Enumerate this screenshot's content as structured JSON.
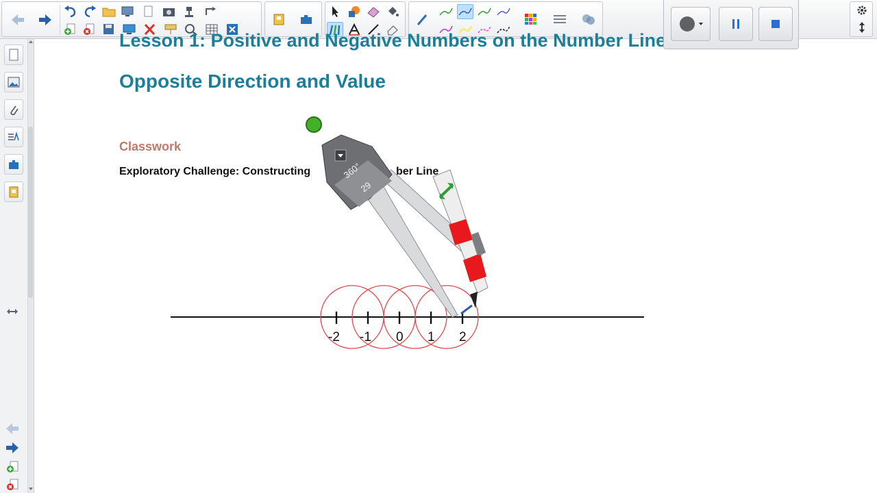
{
  "toolbar": {
    "groups": [
      "navigation",
      "edit",
      "file",
      "gallery",
      "tools",
      "pens",
      "extras"
    ]
  },
  "page": {
    "lesson_title": "Lesson 1:  Positive and Negative Numbers on the Number Line",
    "subtitle": "Opposite Direction and Value",
    "section": "Classwork",
    "challenge_pre": "Exploratory Challenge:  Constructing",
    "challenge_post": "ber Line"
  },
  "number_line": {
    "labels": [
      "-2",
      "-1",
      "0",
      "1",
      "2"
    ],
    "values": [
      -2,
      -1,
      0,
      1,
      2
    ]
  },
  "compass": {
    "angle_label": "360°",
    "radius_label": "29",
    "color": "#e8191c"
  },
  "colors": {
    "title": "#1b7f99",
    "section": "#c07a6a",
    "circle": "#e0474c",
    "accent": "#2b5fa8"
  },
  "icons": {
    "back": "arrow-left-icon",
    "forward": "arrow-right-icon",
    "settings": "gear-icon",
    "move": "up-down-arrow-icon"
  }
}
